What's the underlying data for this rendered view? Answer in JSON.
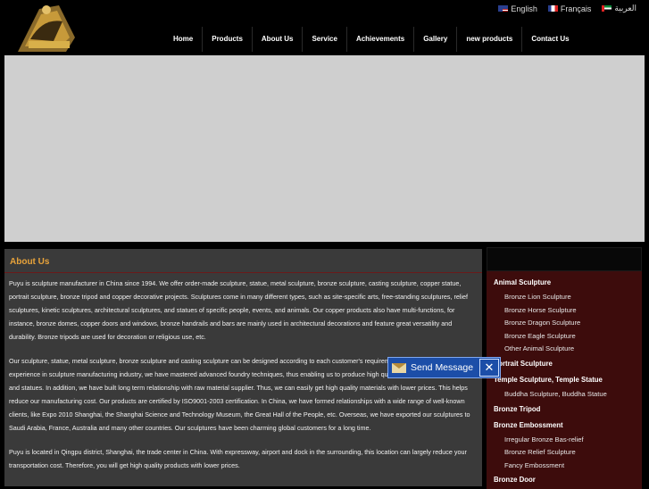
{
  "header": {
    "languages": [
      {
        "label": "English",
        "flag": "us-flag-icon"
      },
      {
        "label": "Français",
        "flag": "fr-flag-icon"
      },
      {
        "label": "العربية",
        "flag": "ae-flag-icon"
      }
    ],
    "nav": [
      "Home",
      "Products",
      "About Us",
      "Service",
      "Achievements",
      "Gallery",
      "new products",
      "Contact Us"
    ]
  },
  "about": {
    "title": "About Us",
    "paragraphs": [
      "Puyu is sculpture manufacturer in China since 1994. We offer order-made sculpture, statue, metal sculpture, bronze sculpture, casting sculpture, copper statue, portrait sculpture, bronze tripod and copper decorative projects. Sculptures come in many different types, such as site-specific arts, free-standing sculptures, relief sculptures, kinetic sculptures, architectural sculptures, and statues of specific people, events, and animals. Our copper products also have multi-functions, for instance, bronze domes, copper doors and windows, bronze handrails and bars are mainly used in architectural decorations and feature great versatility and durability. Bronze tripods are used for decoration or religious use, etc.",
      "Our sculpture, statue, metal sculpture, bronze sculpture and casting sculpture can be designed according to each customer's requirements. With 15 years experience in sculpture manufacturing industry, we have mastered advanced foundry techniques, thus enabling us to produce high quality and exquisite sculptures and statues. In addition, we have built long term relationship with raw material supplier. Thus, we can easily get high quality materials with lower prices. This helps reduce our manufacturing cost. Our products are certified by ISO9001-2003 certification. In China, we have formed relationships with a wide range of well-known clients, like Expo 2010 Shanghai, the Shanghai Science and Technology Museum, the Great Hall of the People, etc. Overseas, we have exported our sculptures to Saudi Arabia, France, Australia and many other countries. Our sculptures have been charming global customers for a long time.",
      "Puyu is located in Qingpu district, Shanghai, the trade center in China. With expressway, airport and dock in the surrounding, this location can largely reduce your transportation cost. Therefore, you will get high quality products with lower prices."
    ]
  },
  "sidebar": {
    "categories": [
      {
        "label": "Animal Sculpture",
        "items": [
          "Bronze Lion Sculpture",
          "Bronze Horse Sculpture",
          "Bronze Dragon Sculpture",
          "Bronze Eagle Sculpture",
          "Other Animal Sculpture"
        ]
      },
      {
        "label": "Portrait Sculpture",
        "items": []
      },
      {
        "label": "Temple Sculpture, Temple Statue",
        "items": [
          "Buddha Sculpture, Buddha Statue"
        ]
      },
      {
        "label": "Bronze Tripod",
        "items": []
      },
      {
        "label": "Bronze Embossment",
        "items": [
          "Irregular Bronze Bas-relief",
          "Bronze Relief Sculpture",
          "Fancy Embossment"
        ]
      },
      {
        "label": "Bronze Door",
        "items": []
      }
    ]
  },
  "send_message": {
    "label": "Send Message"
  }
}
